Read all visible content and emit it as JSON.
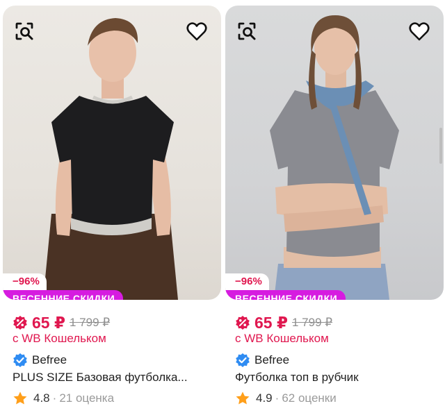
{
  "products": [
    {
      "discount": "−96%",
      "promo": "ВЕСЕННИЕ СКИДКИ",
      "price": "65 ₽",
      "old_price": "1 799 ₽",
      "wallet_note": "с WB Кошельком",
      "brand": "Befree",
      "title": "PLUS SIZE Базовая футболка...",
      "rating": "4.8",
      "separator": "·",
      "reviews": "21 оценка",
      "image_dots": 5,
      "active_dot": 0,
      "garment_color": "#1d1d1f"
    },
    {
      "discount": "−96%",
      "promo": "ВЕСЕННИЕ СКИДКИ",
      "price": "65 ₽",
      "old_price": "1 799 ₽",
      "wallet_note": "с WB Кошельком",
      "brand": "Befree",
      "title": "Футболка топ в рубчик",
      "rating": "4.9",
      "separator": "·",
      "reviews": "62 оценки",
      "image_dots": 5,
      "active_dot": 0,
      "garment_color": "#8a8b91"
    }
  ],
  "icons": {
    "search_similar": "image-search-icon",
    "favorite": "heart-outline-icon",
    "wallet": "wallet-discount-badge-icon",
    "verified": "verified-check-icon",
    "rating": "star-icon"
  },
  "colors": {
    "accent": "#e0174f",
    "promo_bg": "#d61ce0",
    "verified": "#2f8cf2",
    "star": "#ff9f1a"
  }
}
